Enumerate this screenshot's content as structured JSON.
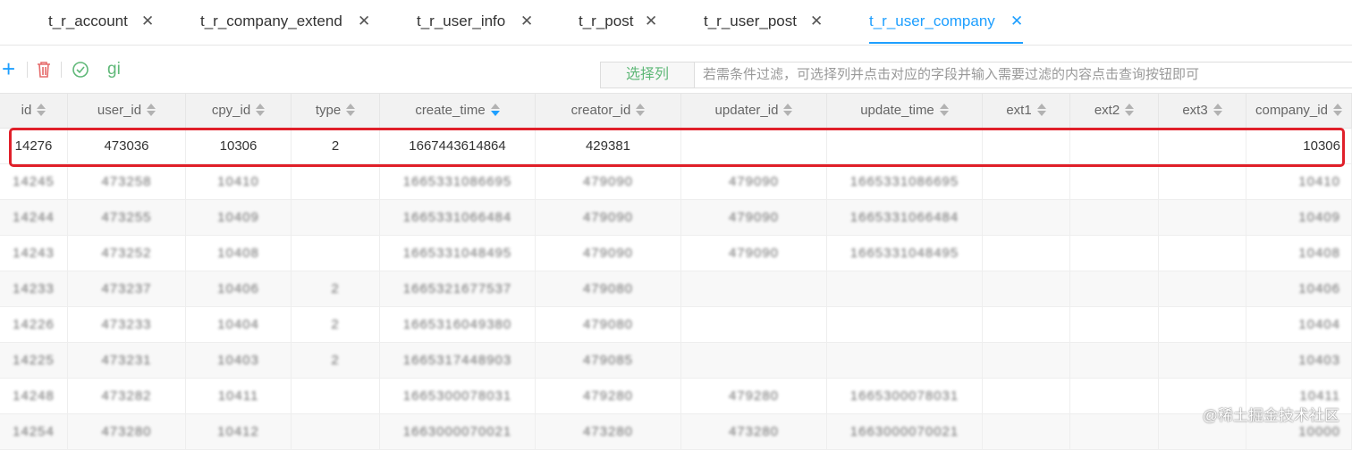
{
  "tabs": {
    "left_fragment": "]",
    "items": [
      {
        "label": "t_r_account",
        "close": "✕"
      },
      {
        "label": "t_r_company_extend",
        "close": "✕"
      },
      {
        "label": "t_r_user_info",
        "close": "✕"
      },
      {
        "label": "t_r_post",
        "close": "✕"
      },
      {
        "label": "t_r_user_post",
        "close": "✕"
      },
      {
        "label": "t_r_user_company",
        "close": "✕",
        "active": true
      }
    ]
  },
  "toolbar": {
    "add_glyph": "+",
    "delete_glyph": "🗑",
    "check_glyph": "⊘",
    "gi_label": "gi",
    "select_columns_label": "选择列",
    "filter_placeholder": "若需条件过滤，可选择列并点击对应的字段并输入需要过滤的内容点击查询按钮即可"
  },
  "table": {
    "columns": [
      "id",
      "user_id",
      "cpy_id",
      "type",
      "create_time",
      "creator_id",
      "updater_id",
      "update_time",
      "ext1",
      "ext2",
      "ext3",
      "company_id"
    ],
    "sorted_column": "create_time",
    "highlighted_row": [
      "14276",
      "473036",
      "10306",
      "2",
      "1667443614864",
      "429381",
      "",
      "",
      "",
      "",
      "",
      "10306"
    ],
    "blurred_rows": [
      [
        "14245",
        "473258",
        "10410",
        "",
        "1665331086695",
        "479090",
        "479090",
        "1665331086695",
        "",
        "",
        "",
        "10410"
      ],
      [
        "14244",
        "473255",
        "10409",
        "",
        "1665331066484",
        "479090",
        "479090",
        "1665331066484",
        "",
        "",
        "",
        "10409"
      ],
      [
        "14243",
        "473252",
        "10408",
        "",
        "1665331048495",
        "479090",
        "479090",
        "1665331048495",
        "",
        "",
        "",
        "10408"
      ],
      [
        "14233",
        "473237",
        "10406",
        "2",
        "1665321677537",
        "479080",
        "",
        "",
        "",
        "",
        "",
        "10406"
      ],
      [
        "14226",
        "473233",
        "10404",
        "2",
        "1665316049380",
        "479080",
        "",
        "",
        "",
        "",
        "",
        "10404"
      ],
      [
        "14225",
        "473231",
        "10403",
        "2",
        "1665317448903",
        "479085",
        "",
        "",
        "",
        "",
        "",
        "10403"
      ],
      [
        "14248",
        "473282",
        "10411",
        "",
        "1665300078031",
        "479280",
        "479280",
        "1665300078031",
        "",
        "",
        "",
        "10411"
      ],
      [
        "14254",
        "473280",
        "10412",
        "",
        "1663000070021",
        "473280",
        "473280",
        "1663000070021",
        "",
        "",
        "",
        "10000"
      ]
    ]
  },
  "watermark": "@稀土掘金技术社区",
  "colors": {
    "accent": "#1e9fff",
    "green": "#5fb878",
    "highlight_border": "#e0202a",
    "header_bg": "#f2f2f2"
  }
}
